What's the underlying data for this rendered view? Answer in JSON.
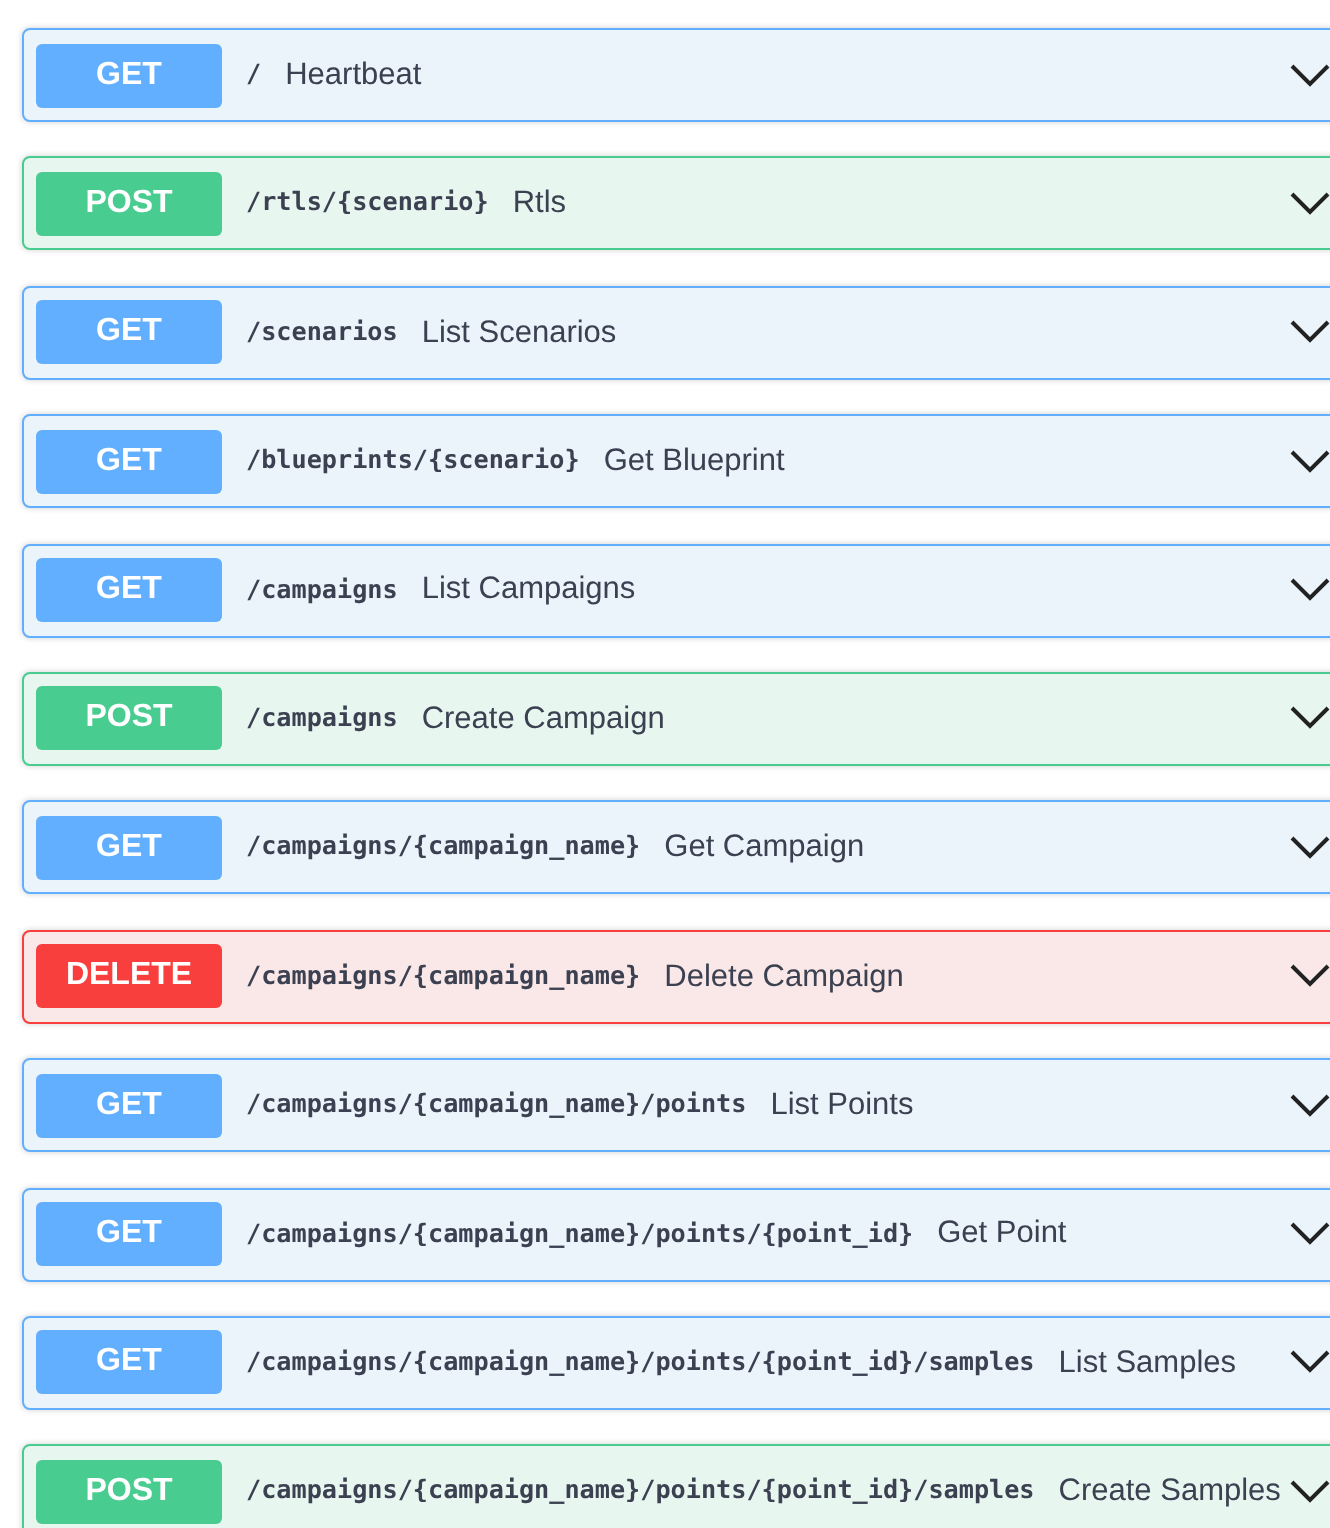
{
  "endpoints": [
    {
      "kind": "get",
      "method": "GET",
      "path": "/",
      "summary": "Heartbeat"
    },
    {
      "kind": "post",
      "method": "POST",
      "path": "/rtls/{scenario}",
      "summary": "Rtls"
    },
    {
      "kind": "get",
      "method": "GET",
      "path": "/scenarios",
      "summary": "List Scenarios"
    },
    {
      "kind": "get",
      "method": "GET",
      "path": "/blueprints/{scenario}",
      "summary": "Get Blueprint"
    },
    {
      "kind": "get",
      "method": "GET",
      "path": "/campaigns",
      "summary": "List Campaigns"
    },
    {
      "kind": "post",
      "method": "POST",
      "path": "/campaigns",
      "summary": "Create Campaign"
    },
    {
      "kind": "get",
      "method": "GET",
      "path": "/campaigns/{campaign_name}",
      "summary": "Get Campaign"
    },
    {
      "kind": "delete",
      "method": "DELETE",
      "path": "/campaigns/{campaign_name}",
      "summary": "Delete Campaign"
    },
    {
      "kind": "get",
      "method": "GET",
      "path": "/campaigns/{campaign_name}/points",
      "summary": "List Points"
    },
    {
      "kind": "get",
      "method": "GET",
      "path": "/campaigns/{campaign_name}/points/{point_id}",
      "summary": "Get Point"
    },
    {
      "kind": "get",
      "method": "GET",
      "path": "/campaigns/{campaign_name}/points/{point_id}/samples",
      "summary": "List Samples"
    },
    {
      "kind": "post",
      "method": "POST",
      "path": "/campaigns/{campaign_name}/points/{point_id}/samples",
      "summary": "Create Samples"
    }
  ]
}
